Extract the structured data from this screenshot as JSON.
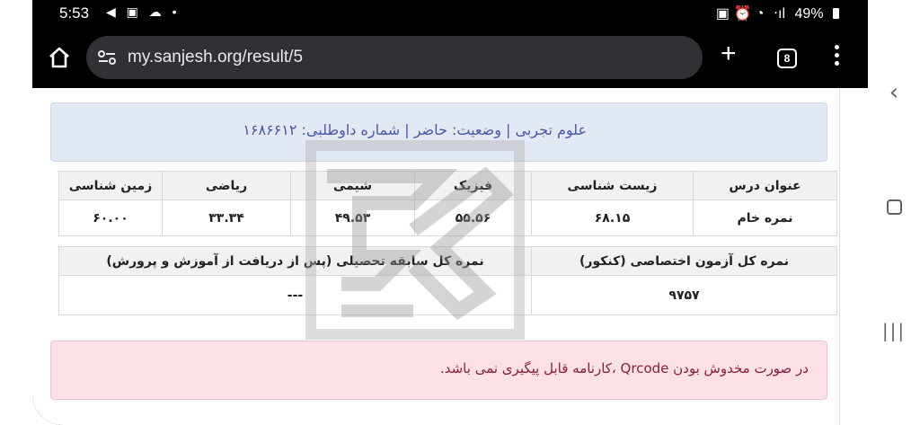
{
  "status_bar": {
    "time": "5:53",
    "left_icons": "◀ ▣ ☁ •",
    "right_icons": "▣ ⏰ ◔",
    "signal": "‧ıl",
    "battery": "49%"
  },
  "browser": {
    "url": "my.sanjesh.org/result/5",
    "tab_count": "8",
    "new_tab_label": "+"
  },
  "info": {
    "text": "علوم تجربی | وضعیت: حاضر | شماره داوطلبی: ۱۶۸۶۶۱۲"
  },
  "scores_table": {
    "headers": [
      "عنوان درس",
      "زیست شناسی",
      "فیزیک",
      "شیمی",
      "ریاضی",
      "زمین شناسی"
    ],
    "row": [
      "نمره خام",
      "۶۸.۱۵",
      "۵۵.۵۶",
      "۴۹.۵۳",
      "۳۳.۳۴",
      "۶۰.۰۰"
    ]
  },
  "totals_table": {
    "headers": [
      "نمره کل آزمون اختصاصی (کنکور)",
      "نمره کل سابقه تحصیلی (پس از دریافت از آموزش و پرورش)"
    ],
    "row": [
      "۹۷۵۷",
      "---"
    ]
  },
  "alert": {
    "text": "در صورت مخدوش بودن Qrcode ،کارنامه قابل پیگیری نمی باشد."
  },
  "nav": {
    "back": "‹",
    "recents": "|||"
  }
}
